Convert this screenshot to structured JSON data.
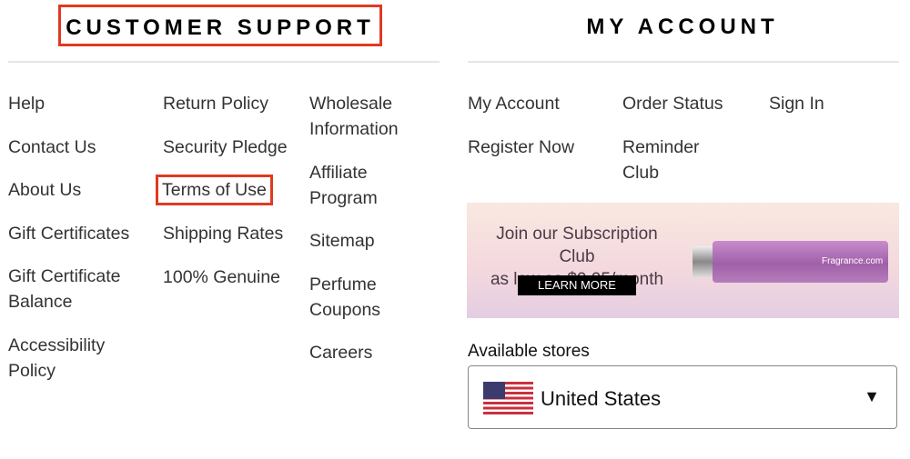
{
  "customer_support": {
    "title": "CUSTOMER SUPPORT",
    "columns": [
      [
        "Help",
        "Contact Us",
        "About Us",
        "Gift Certificates",
        "Gift Certificate Balance",
        "Accessibility Policy"
      ],
      [
        "Return Policy",
        "Security Pledge",
        "Terms of Use",
        "Shipping Rates",
        "100% Genuine"
      ],
      [
        "Wholesale Information",
        "Affiliate Program",
        "Sitemap",
        "Perfume Coupons",
        "Careers"
      ]
    ]
  },
  "my_account": {
    "title": "MY ACCOUNT",
    "columns": [
      [
        "My Account",
        "Register Now"
      ],
      [
        "Order Status",
        "Reminder Club"
      ],
      [
        "Sign In"
      ]
    ]
  },
  "banner": {
    "line1": "Join our Subscription Club",
    "line2": "as low as $9.95/month",
    "button": "LEARN MORE",
    "logo": "Fragrance.com"
  },
  "stores": {
    "label": "Available stores",
    "selected": "United States",
    "flag_icon": "us-flag-icon"
  },
  "highlight_color": "#e03a22"
}
